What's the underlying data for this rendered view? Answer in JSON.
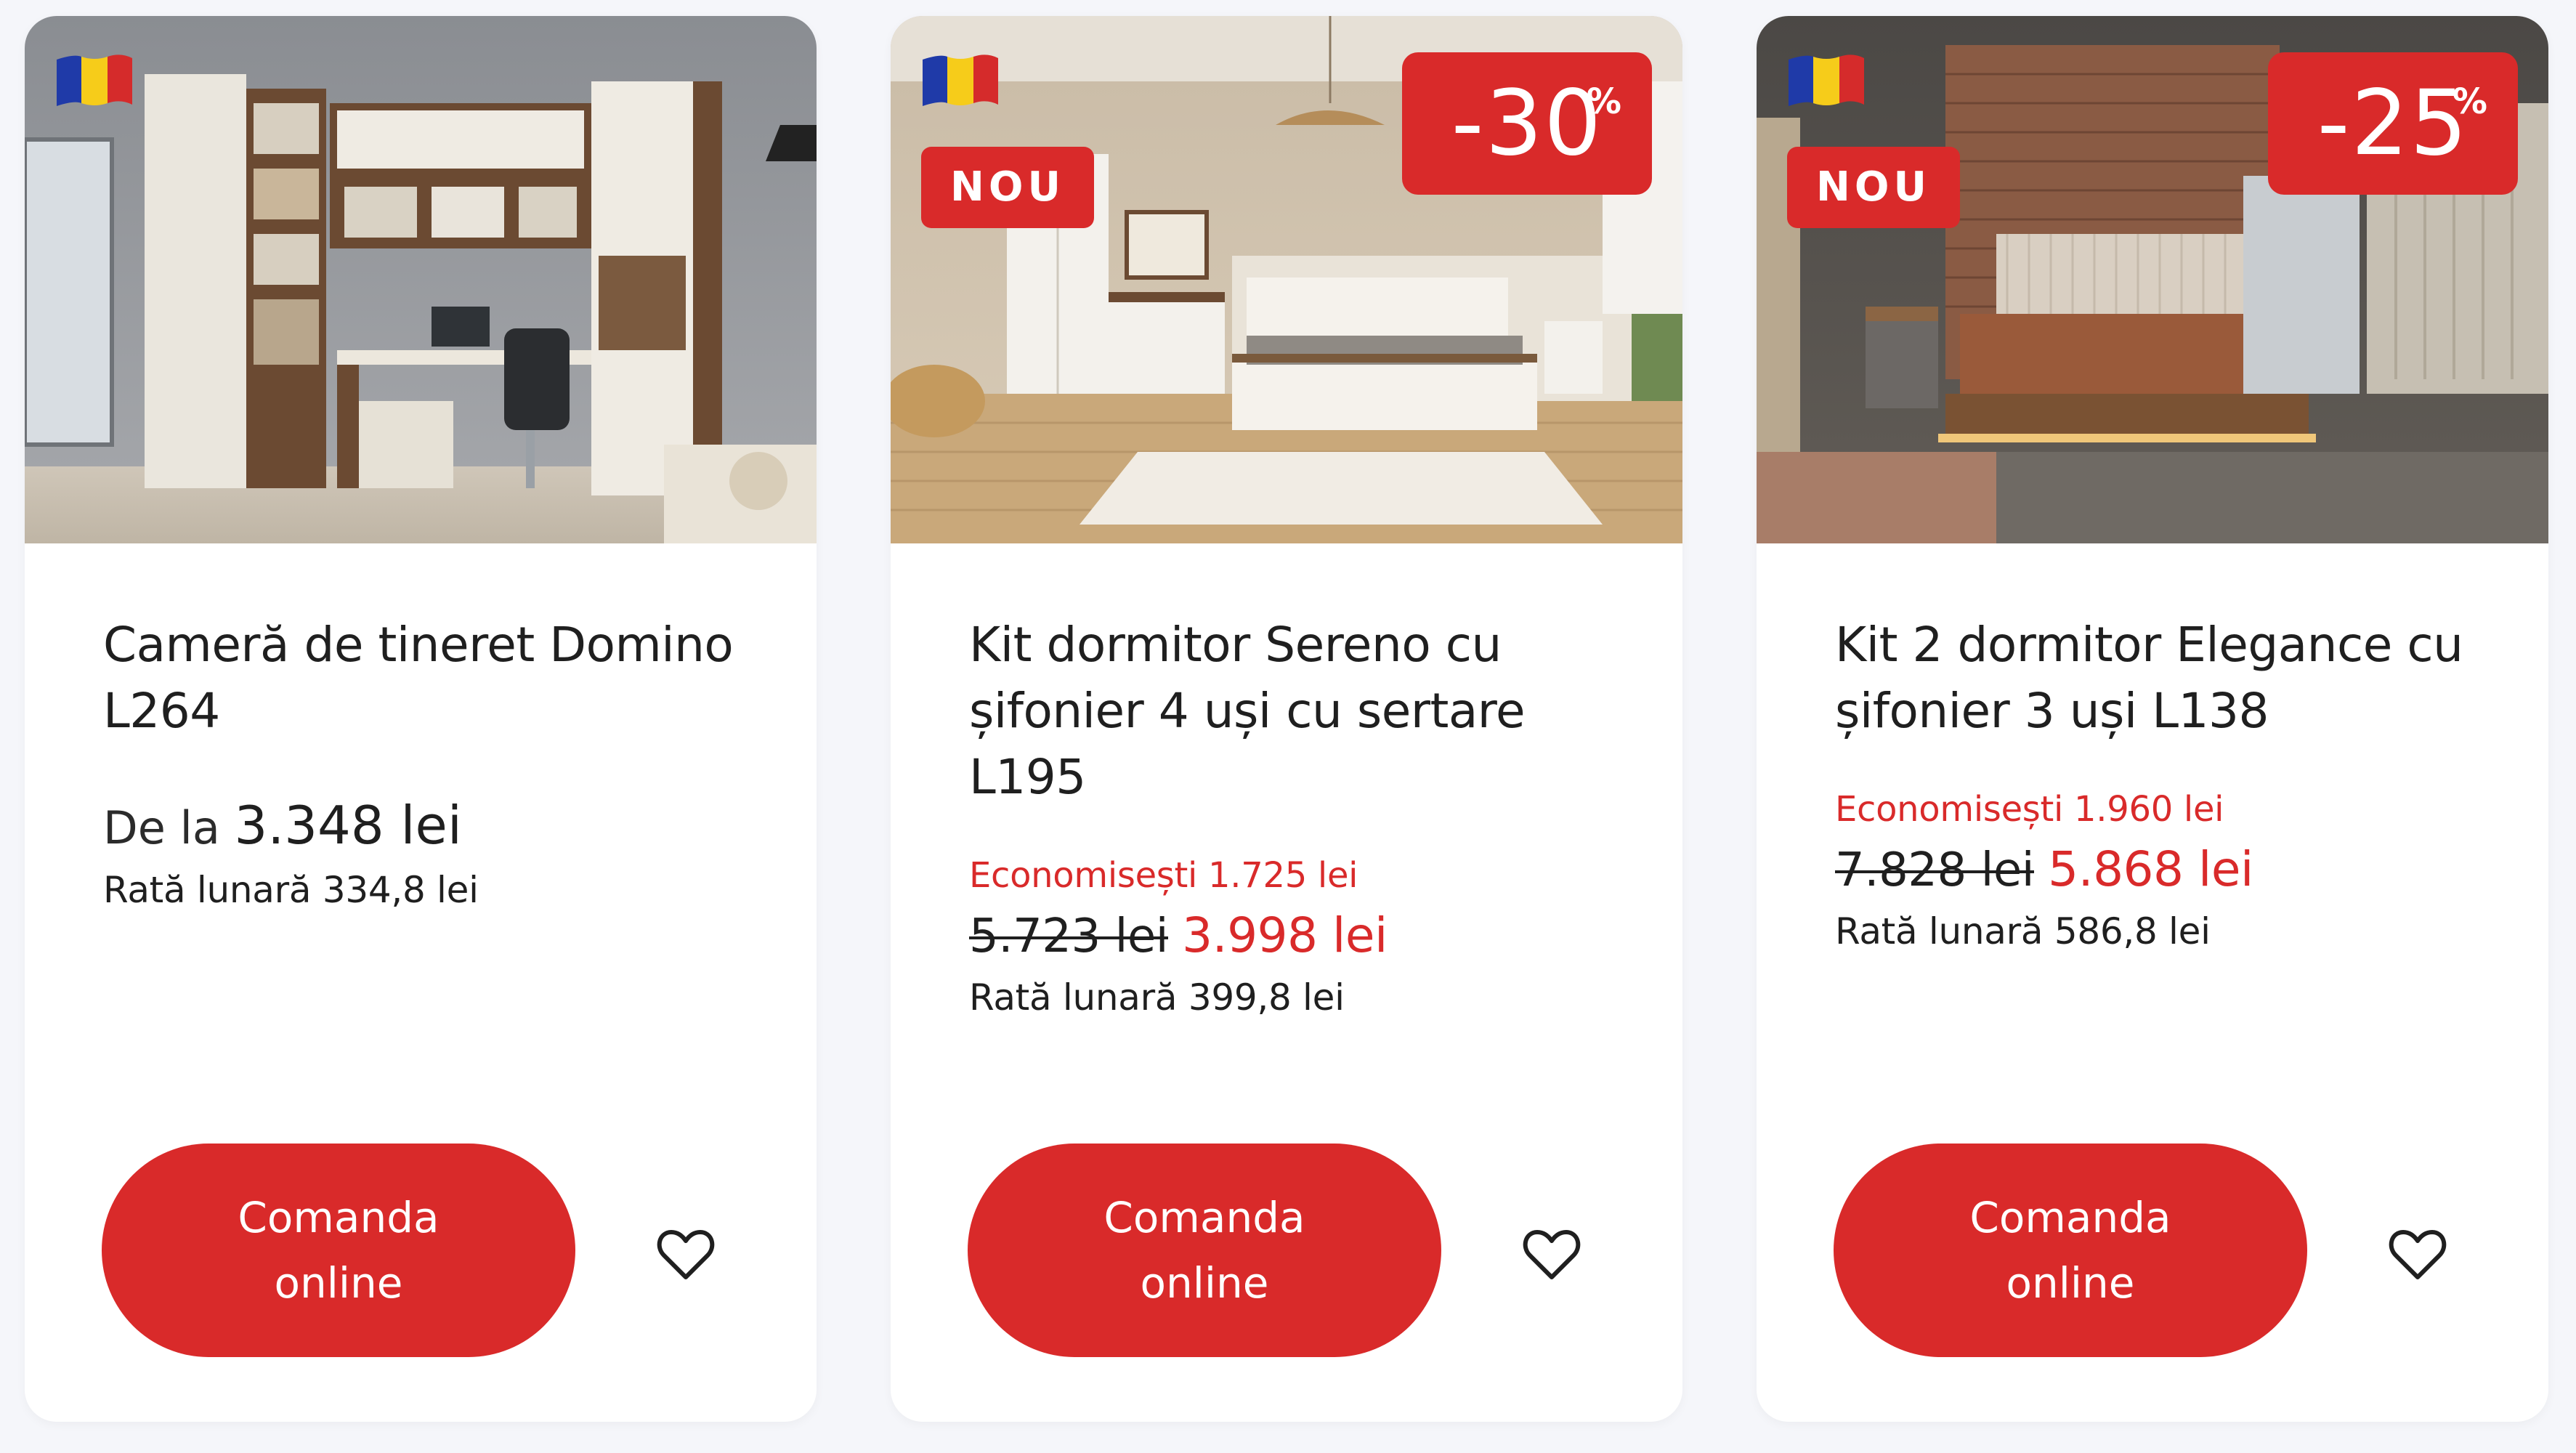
{
  "colors": {
    "accent": "#d92a2a",
    "page_background": "#f5f6fa",
    "card_background": "#ffffff"
  },
  "products": [
    {
      "title": "Cameră de tineret Domino L264",
      "flag_icon": "romania-flag-icon",
      "badge_new": null,
      "discount": null,
      "from_label": "De la",
      "from_price": "3.348 lei",
      "savings_label": null,
      "savings_amount": null,
      "old_price": null,
      "new_price": null,
      "monthly_rate": "Rată lunară 334,8 lei",
      "cta_line1": "Comanda",
      "cta_line2": "online",
      "favorite_icon": "heart-outline-icon"
    },
    {
      "title": "Kit dormitor Sereno cu șifonier 4 uși cu sertare L195",
      "flag_icon": "romania-flag-icon",
      "badge_new": "NOU",
      "discount": "-30",
      "discount_suffix": "%",
      "savings_label": "Economisești",
      "savings_amount": "1.725 lei",
      "old_price": "5.723 lei",
      "new_price": "3.998 lei",
      "monthly_rate": "Rată lunară 399,8 lei",
      "cta_line1": "Comanda",
      "cta_line2": "online",
      "favorite_icon": "heart-outline-icon"
    },
    {
      "title": "Kit 2 dormitor Elegance cu șifonier 3 uși L138",
      "flag_icon": "romania-flag-icon",
      "badge_new": "NOU",
      "discount": "-25",
      "discount_suffix": "%",
      "savings_label": "Economisești",
      "savings_amount": "1.960 lei",
      "old_price": "7.828 lei",
      "new_price": "5.868 lei",
      "monthly_rate": "Rată lunară 586,8 lei",
      "cta_line1": "Comanda",
      "cta_line2": "online",
      "favorite_icon": "heart-outline-icon"
    }
  ]
}
